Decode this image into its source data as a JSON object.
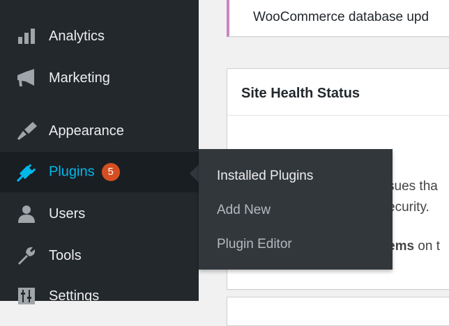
{
  "sidebar": {
    "items": [
      {
        "label": "Analytics",
        "icon": "bar-chart-icon"
      },
      {
        "label": "Marketing",
        "icon": "megaphone-icon"
      },
      {
        "label": "Appearance",
        "icon": "paintbrush-icon"
      },
      {
        "label": "Plugins",
        "icon": "plug-icon",
        "badge": "5",
        "active": true
      },
      {
        "label": "Users",
        "icon": "user-icon"
      },
      {
        "label": "Tools",
        "icon": "wrench-icon"
      },
      {
        "label": "Settings",
        "icon": "sliders-icon"
      }
    ]
  },
  "flyout": {
    "items": [
      {
        "label": "Installed Plugins"
      },
      {
        "label": "Add New"
      },
      {
        "label": "Plugin Editor"
      }
    ]
  },
  "notice": {
    "text": "WooCommerce database upd"
  },
  "site_health": {
    "title": "Site Health Status",
    "line1": "sues tha",
    "line2": "ecurity.",
    "line3_bold": "ems",
    "line3_rest": " on t"
  },
  "colors": {
    "sidebar_bg": "#23282d",
    "active_bg": "#191e23",
    "active_text": "#00b9eb",
    "badge_bg": "#d54e21",
    "flyout_bg": "#32373c",
    "notice_border": "#c986c2"
  }
}
